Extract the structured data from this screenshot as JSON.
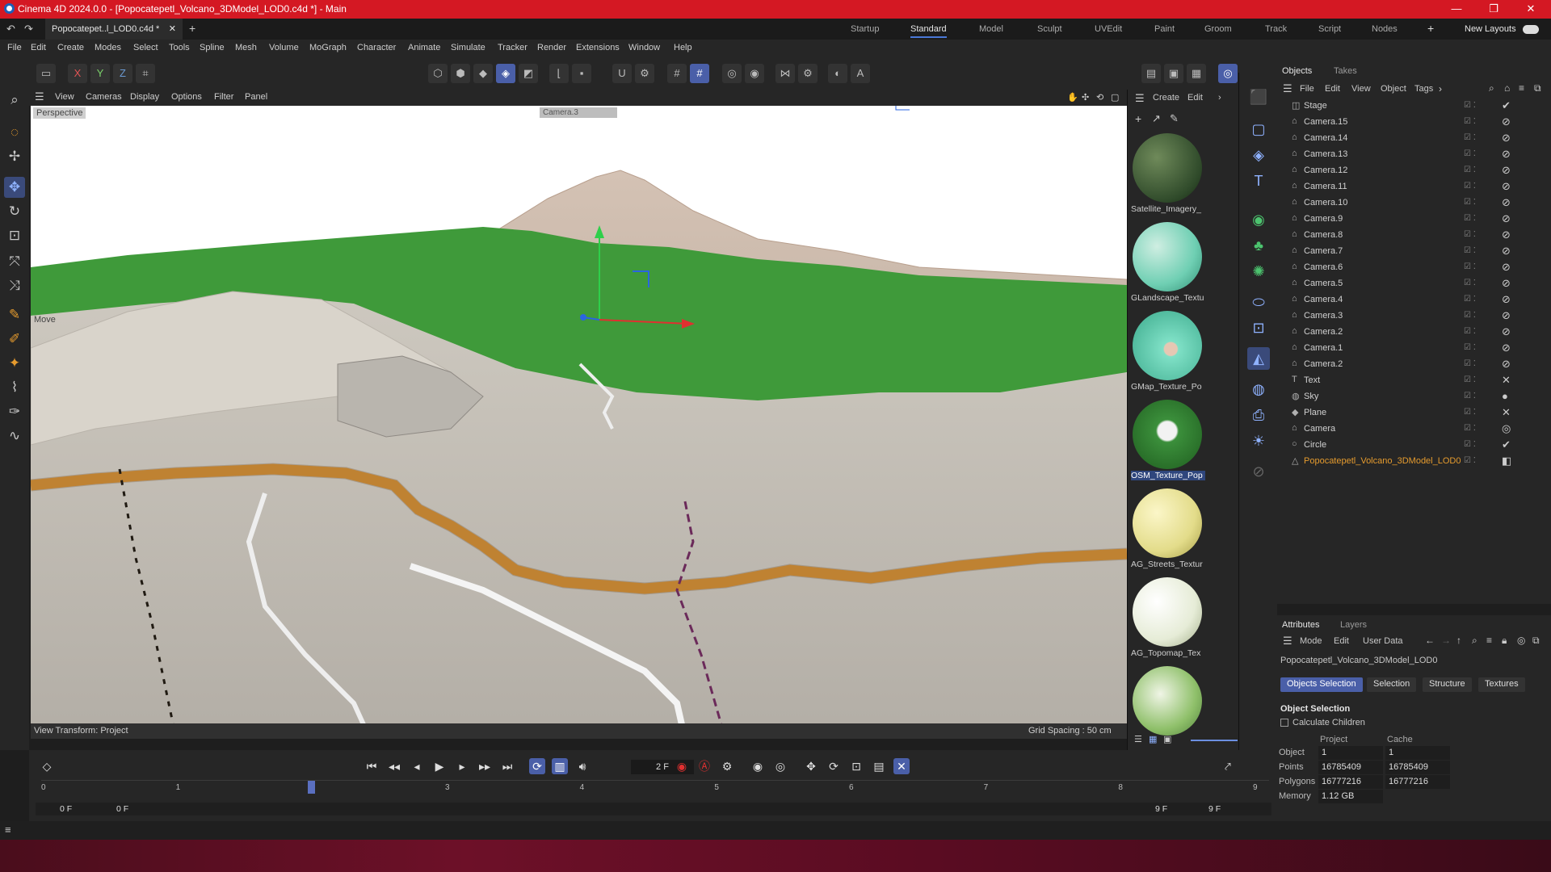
{
  "window": {
    "title": "Cinema 4D 2024.0.0 - [Popocatepetl_Volcano_3DModel_LOD0.c4d *] - Main",
    "controls": [
      "—",
      "❐",
      "✕"
    ]
  },
  "tabbar": {
    "doc_tab": "Popocatepet..l_LOD0.c4d *",
    "close": "✕",
    "add": "+",
    "layouts": [
      "Startup",
      "Standard",
      "Model",
      "Sculpt",
      "UVEdit",
      "Paint",
      "Groom",
      "Track",
      "Script",
      "Nodes"
    ],
    "active_layout": "Standard",
    "new_layouts": "New Layouts"
  },
  "menubar": [
    "File",
    "Edit",
    "Create",
    "Modes",
    "Select",
    "Tools",
    "Spline",
    "Mesh",
    "Volume",
    "MoGraph",
    "Character",
    "Animate",
    "Simulate",
    "Tracker",
    "Render",
    "Extensions",
    "Window",
    "Help"
  ],
  "toolbar": {
    "axis_x": "X",
    "axis_y": "Y",
    "axis_z": "Z"
  },
  "viewport": {
    "menu": [
      "View",
      "Cameras",
      "Display",
      "Options",
      "Filter",
      "Panel"
    ],
    "projection": "Perspective",
    "camera": "Camera.3",
    "tool_label": "Move",
    "view_transform": "View Transform: Project",
    "grid_spacing": "Grid Spacing : 50 cm"
  },
  "materials": {
    "menu": [
      "Create",
      "Edit"
    ],
    "items": [
      {
        "name": "Satellite_Imagery_",
        "color": "#2f4a2a"
      },
      {
        "name": "GLandscape_Textu",
        "color": "#6fcfb3"
      },
      {
        "name": "GMap_Texture_Po",
        "color": "#7fe0c6"
      },
      {
        "name": "OSM_Texture_Pop",
        "color": "#3b8f3b",
        "selected": true
      },
      {
        "name": "AG_Streets_Textur",
        "color": "#e3dc8a"
      },
      {
        "name": "AG_Topomap_Tex",
        "color": "#e6ecd7"
      }
    ]
  },
  "objects": {
    "tabs": [
      "Objects",
      "Takes"
    ],
    "menu": [
      "File",
      "Edit",
      "View",
      "Object",
      "Tags"
    ],
    "rows": [
      {
        "name": "Stage",
        "icon": "◫",
        "tag": "✔"
      },
      {
        "name": "Camera.15",
        "icon": "⌂",
        "tag": "⊘"
      },
      {
        "name": "Camera.14",
        "icon": "⌂",
        "tag": "⊘"
      },
      {
        "name": "Camera.13",
        "icon": "⌂",
        "tag": "⊘"
      },
      {
        "name": "Camera.12",
        "icon": "⌂",
        "tag": "⊘"
      },
      {
        "name": "Camera.11",
        "icon": "⌂",
        "tag": "⊘"
      },
      {
        "name": "Camera.10",
        "icon": "⌂",
        "tag": "⊘"
      },
      {
        "name": "Camera.9",
        "icon": "⌂",
        "tag": "⊘"
      },
      {
        "name": "Camera.8",
        "icon": "⌂",
        "tag": "⊘"
      },
      {
        "name": "Camera.7",
        "icon": "⌂",
        "tag": "⊘"
      },
      {
        "name": "Camera.6",
        "icon": "⌂",
        "tag": "⊘"
      },
      {
        "name": "Camera.5",
        "icon": "⌂",
        "tag": "⊘"
      },
      {
        "name": "Camera.4",
        "icon": "⌂",
        "tag": "⊘"
      },
      {
        "name": "Camera.3",
        "icon": "⌂",
        "tag": "⊘"
      },
      {
        "name": "Camera.2",
        "icon": "⌂",
        "tag": "⊘"
      },
      {
        "name": "Camera.1",
        "icon": "⌂",
        "tag": "⊘"
      },
      {
        "name": "Camera.2",
        "icon": "⌂",
        "tag": "⊘"
      },
      {
        "name": "Text",
        "icon": "T",
        "tag": "✕"
      },
      {
        "name": "Sky",
        "icon": "◍",
        "tag": "●"
      },
      {
        "name": "Plane",
        "icon": "◆",
        "tag": "✕"
      },
      {
        "name": "Camera",
        "icon": "⌂",
        "tag": "◎"
      },
      {
        "name": "Circle",
        "icon": "○",
        "tag": "✔"
      },
      {
        "name": "Popocatepetl_Volcano_3DModel_LOD0",
        "icon": "△",
        "tag": "◧",
        "highlight": true
      }
    ]
  },
  "attributes": {
    "tabs": [
      "Attributes",
      "Layers"
    ],
    "menu": [
      "Mode",
      "Edit",
      "User Data"
    ],
    "object_name": "Popocatepetl_Volcano_3DModel_LOD0",
    "buttons": [
      "Objects Selection",
      "Selection",
      "Structure",
      "Textures"
    ],
    "section": "Object Selection",
    "checkbox": "Calculate Children",
    "col_project": "Project",
    "col_cache": "Cache",
    "rows": [
      {
        "label": "Object",
        "project": "1",
        "cache": "1"
      },
      {
        "label": "Points",
        "project": "16785409",
        "cache": "16785409"
      },
      {
        "label": "Polygons",
        "project": "16777216",
        "cache": "16777216"
      },
      {
        "label": "Memory",
        "project": "1.12 GB",
        "cache": ""
      }
    ]
  },
  "timeline": {
    "current_frame": "2 F",
    "ticks": [
      "0",
      "1",
      "2",
      "3",
      "4",
      "5",
      "6",
      "7",
      "8",
      "9"
    ],
    "range_start": "0 F",
    "range_start2": "0 F",
    "range_end": "9 F",
    "range_end2": "9 F",
    "playhead_frame": 2,
    "total_frames": 9
  },
  "colors": {
    "titlebar": "#d41823",
    "accent": "#4a5fa8",
    "terrain_green": "#3f9a3a",
    "road_orange": "#e09a3a"
  }
}
